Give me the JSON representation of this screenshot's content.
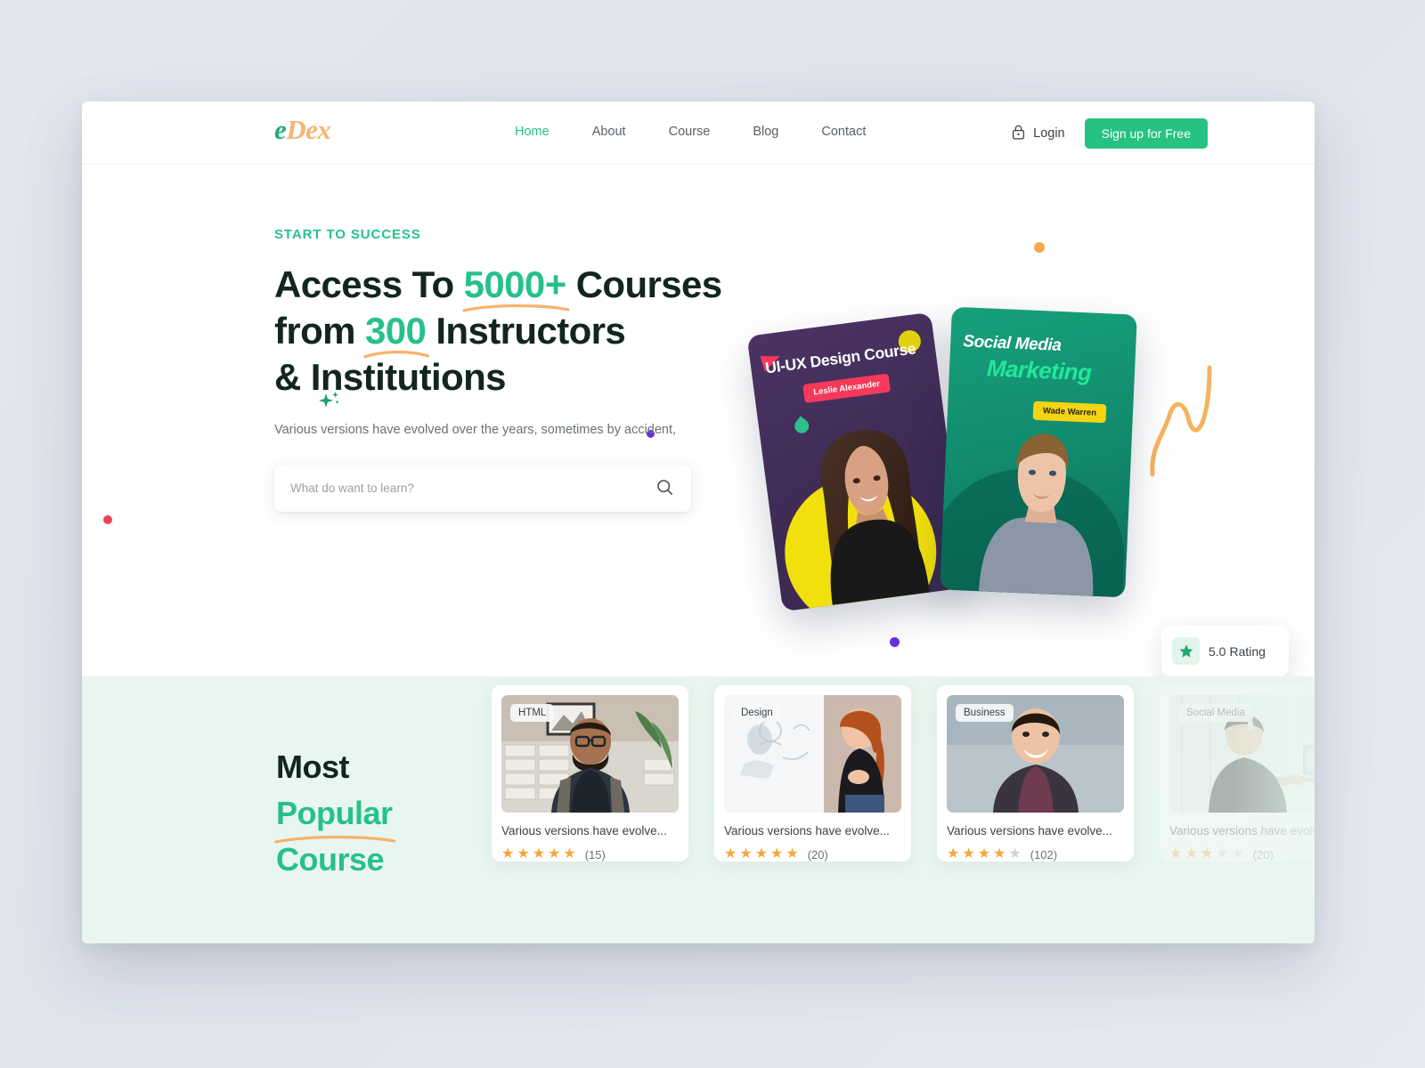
{
  "brand": {
    "logo_first": "e",
    "logo_rest": "Dex",
    "green": "#27c08a",
    "orange": "#f7b472",
    "dark": "#12261d"
  },
  "header": {
    "nav": [
      {
        "label": "Home",
        "active": true
      },
      {
        "label": "About",
        "active": false
      },
      {
        "label": "Course",
        "active": false
      },
      {
        "label": "Blog",
        "active": false
      },
      {
        "label": "Contact",
        "active": false
      }
    ],
    "login_label": "Login",
    "login_icon": "lock-icon",
    "signup_label": "Sign up for Free"
  },
  "hero": {
    "eyebrow": "START TO SUCCESS",
    "headline": {
      "line1_a": "Access To ",
      "line1_highlight": "5000+",
      "line1_b": " Courses",
      "line2_a": "from ",
      "line2_highlight": "300",
      "line2_b": " Instructors",
      "line3": "& Institutions"
    },
    "subtitle": "Various versions have evolved over the years, sometimes by accident,",
    "search": {
      "placeholder": "What do want to learn?",
      "value": "",
      "icon": "search-icon"
    },
    "cards": [
      {
        "title": "UI-UX Design Course",
        "instructor": "Leslie Alexander",
        "badge_color": "#f5395b",
        "bg_color": "#3e2b54"
      },
      {
        "title_line1": "Social Media",
        "title_line2": "Marketing",
        "instructor": "Wade Warren",
        "badge_color": "#f5d512",
        "bg_color": "#11886c"
      }
    ],
    "rating_badge": {
      "icon": "star-icon",
      "value": "5.0",
      "label": "Rating"
    },
    "decorations": {
      "sparkle_green": "sparkle-icon",
      "sparkle_orange": "sparkle-icon",
      "dot_orange": "#f4a94e",
      "dot_purple": "#6b2fe0",
      "dot_red": "#f04054",
      "squiggle": "#f5b35e"
    }
  },
  "popular": {
    "heading_line1": "Most",
    "heading_line2": "Popular",
    "heading_line3": "Course",
    "courses": [
      {
        "badge": "HTML",
        "title": "Various versions have evolve...",
        "stars": 5,
        "count": "(15)"
      },
      {
        "badge": "Design",
        "title": "Various versions have evolve...",
        "stars": 5,
        "count": "(20)"
      },
      {
        "badge": "Business",
        "title": "Various versions have evolve...",
        "stars": 4,
        "count": "(102)"
      },
      {
        "badge": "Social Media",
        "title": "Various versions have evolve...",
        "stars": 3,
        "count": "(20)"
      }
    ]
  }
}
